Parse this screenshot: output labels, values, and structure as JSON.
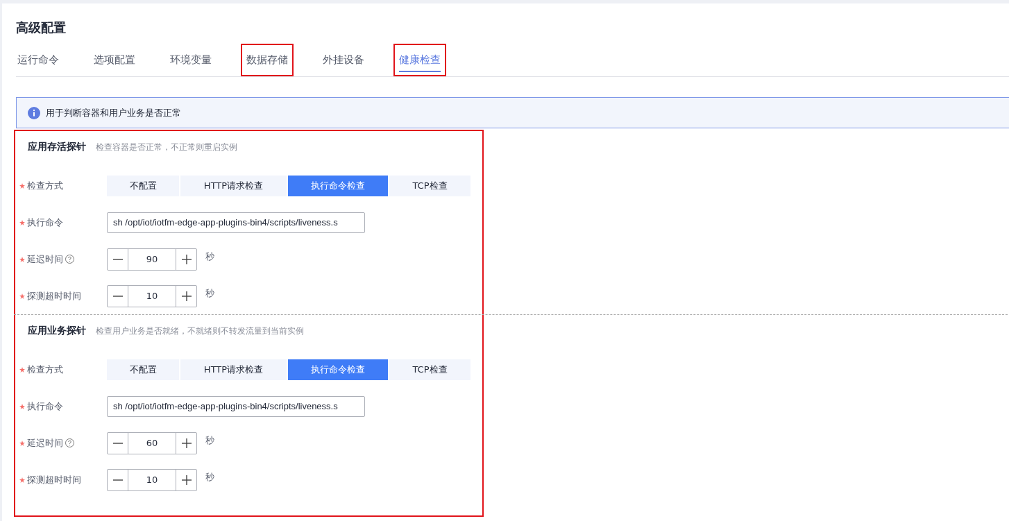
{
  "title": "高级配置",
  "tabs": [
    {
      "label": "运行命令",
      "selected": false,
      "highlighted": false
    },
    {
      "label": "选项配置",
      "selected": false,
      "highlighted": false
    },
    {
      "label": "环境变量",
      "selected": false,
      "highlighted": false
    },
    {
      "label": "数据存储",
      "selected": false,
      "highlighted": true
    },
    {
      "label": "外挂设备",
      "selected": false,
      "highlighted": false
    },
    {
      "label": "健康检查",
      "selected": true,
      "highlighted": true
    }
  ],
  "info": {
    "text": "用于判断容器和用户业务是否正常"
  },
  "probes_highlighted": true,
  "probes": [
    {
      "title": "应用存活探针",
      "description": "检查容器是否正常，不正常则重启实例",
      "fields": [
        {
          "kind": "segmented",
          "label": "检查方式",
          "required": true,
          "options": [
            {
              "label": "不配置",
              "selected": false
            },
            {
              "label": "HTTP请求检查",
              "selected": false
            },
            {
              "label": "执行命令检查",
              "selected": true
            },
            {
              "label": "TCP检查",
              "selected": false
            }
          ]
        },
        {
          "kind": "text",
          "label": "执行命令",
          "required": true,
          "value": "sh /opt/iot/iotfm-edge-app-plugins-bin4/scripts/liveness.s"
        },
        {
          "kind": "stepper",
          "label": "延迟时间",
          "required": true,
          "help": true,
          "value": "90",
          "unit": "秒"
        },
        {
          "kind": "stepper",
          "label": "探测超时时间",
          "required": true,
          "help": false,
          "value": "10",
          "unit": "秒"
        }
      ]
    },
    {
      "title": "应用业务探针",
      "description": "检查用户业务是否就绪，不就绪则不转发流量到当前实例",
      "fields": [
        {
          "kind": "segmented",
          "label": "检查方式",
          "required": true,
          "options": [
            {
              "label": "不配置",
              "selected": false
            },
            {
              "label": "HTTP请求检查",
              "selected": false
            },
            {
              "label": "执行命令检查",
              "selected": true
            },
            {
              "label": "TCP检查",
              "selected": false
            }
          ]
        },
        {
          "kind": "text",
          "label": "执行命令",
          "required": true,
          "value": "sh /opt/iot/iotfm-edge-app-plugins-bin4/scripts/liveness.s"
        },
        {
          "kind": "stepper",
          "label": "延迟时间",
          "required": true,
          "help": true,
          "value": "60",
          "unit": "秒"
        },
        {
          "kind": "stepper",
          "label": "探测超时时间",
          "required": true,
          "help": false,
          "value": "10",
          "unit": "秒"
        }
      ]
    }
  ]
}
